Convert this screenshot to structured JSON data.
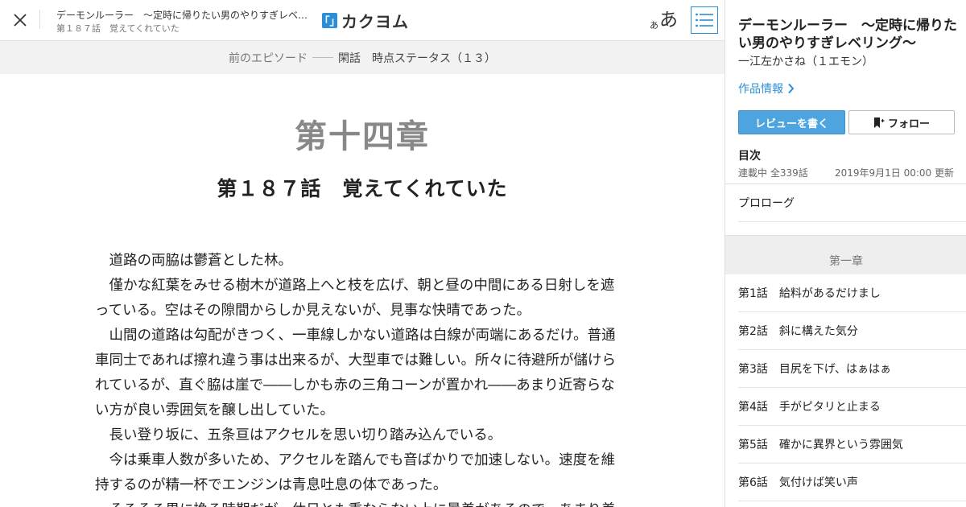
{
  "header": {
    "work_title_short": "デーモンルーラー　～定時に帰りたい男のやりすぎレベ…",
    "episode_title_short": "第１８７話　覚えてくれていた",
    "logo_mark": "「」",
    "logo_text": "カクヨム",
    "font_size_small": "あ",
    "font_size_large": "あ"
  },
  "prev_episode": {
    "label": "前のエピソード",
    "title": "閑話　時点ステータス（１３）"
  },
  "content": {
    "chapter": "第十四章",
    "episode": "第１８７話　覚えてくれていた",
    "paragraphs": [
      "道路の両脇は鬱蒼とした林。",
      "僅かな紅葉をみせる樹木が道路上へと枝を広げ、朝と昼の中間にある日射しを遮っている。空はその隙間からしか見えないが、見事な快晴であった。",
      "山間の道路は勾配がきつく、一車線しかない道路は白線が両端にあるだけ。普通車同士であれば擦れ違う事は出来るが、大型車では難しい。所々に待避所が儲けられているが、直ぐ脇は崖で――しかも赤の三角コーンが置かれ――あまり近寄らない方が良い雰囲気を醸し出していた。",
      "長い登り坂に、五条亘はアクセルを思い切り踏み込んでいる。",
      "今は乗車人数が多いため、アクセルを踏んでも音ばかりで加速しない。速度を維持するのが精一杯でエンジンは青息吐息の体であった。",
      "そろそろ男に換る時期だが、休日とも重ならない上に暑差があるので、あまり差"
    ]
  },
  "sidebar": {
    "work_title": "デーモンルーラー　～定時に帰りたい男のやりすぎレベリング～",
    "author": "一江左かさね（１エモン）",
    "work_info_label": "作品情報",
    "review_label": "レビューを書く",
    "follow_label": "フォロー",
    "toc_heading": "目次",
    "toc_status": "連載中 全339話",
    "toc_updated": "2019年9月1日 00:00 更新",
    "prologue": "プロローグ",
    "chapter_label": "第一章",
    "episodes": [
      {
        "num": "第1話",
        "title": "給料があるだけまし"
      },
      {
        "num": "第2話",
        "title": "斜に構えた気分"
      },
      {
        "num": "第3話",
        "title": "目尻を下げ、はぁはぁ"
      },
      {
        "num": "第4話",
        "title": "手がピタリと止まる"
      },
      {
        "num": "第5話",
        "title": "確かに異界という雰囲気"
      },
      {
        "num": "第6話",
        "title": "気付けば笑い声"
      }
    ]
  },
  "colors": {
    "accent": "#2a8fd6",
    "review_button": "#4ea4df"
  }
}
